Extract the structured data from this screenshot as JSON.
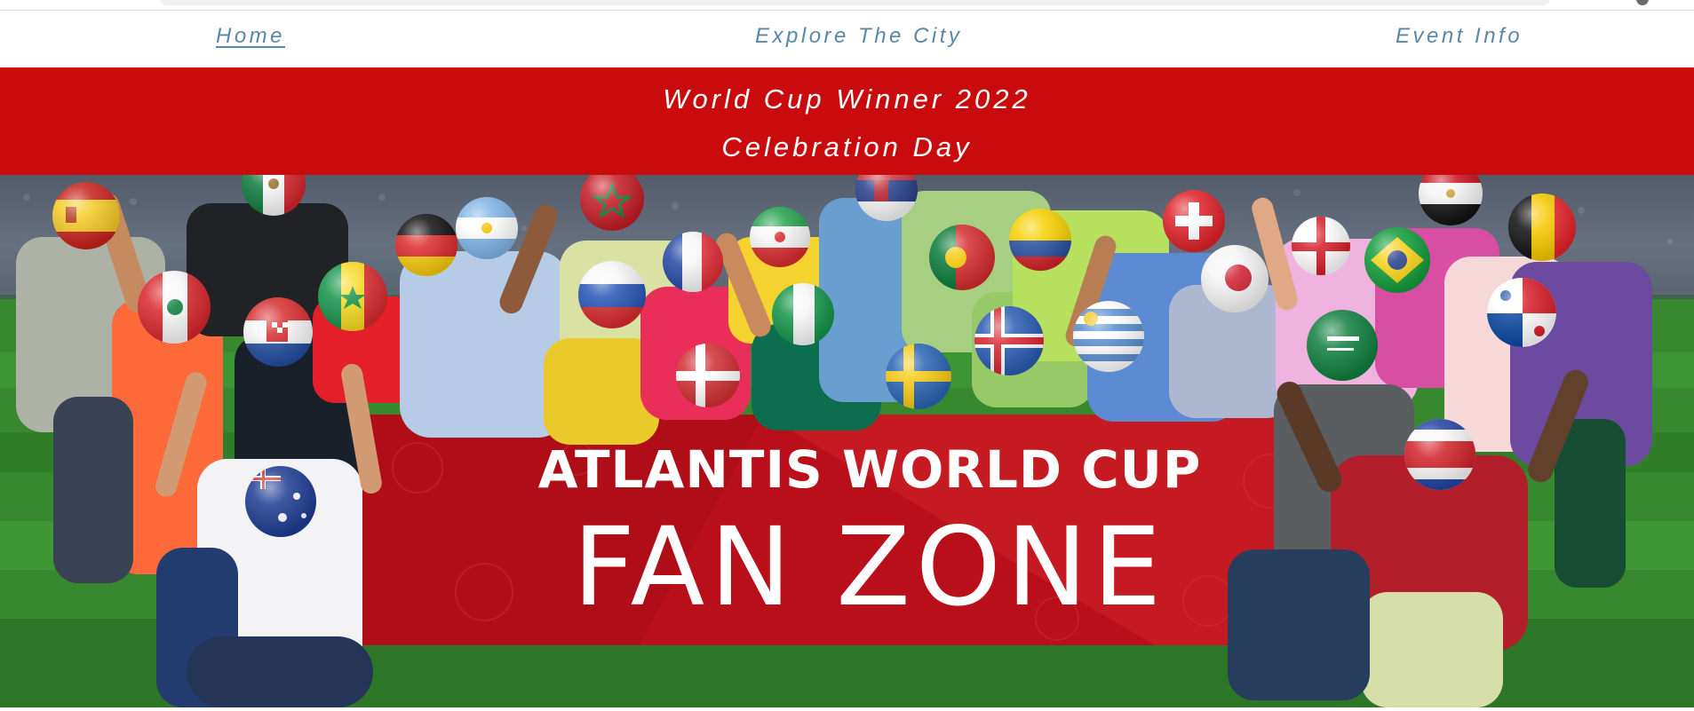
{
  "nav": {
    "home": "Home",
    "explore": "Explore The City",
    "event": "Event Info"
  },
  "banner": {
    "line1": "World Cup Winner 2022",
    "line2": "Celebration Day"
  },
  "hero": {
    "title": "ATLANTIS WORLD CUP",
    "subtitle": "FAN ZONE"
  },
  "colors": {
    "nav_link": "#5a87a6",
    "banner_red": "#c90b0e",
    "hero_red": "#b90f1b",
    "grass": "#3f9436"
  },
  "icons": {
    "browser_control": "browser-control-icon"
  }
}
